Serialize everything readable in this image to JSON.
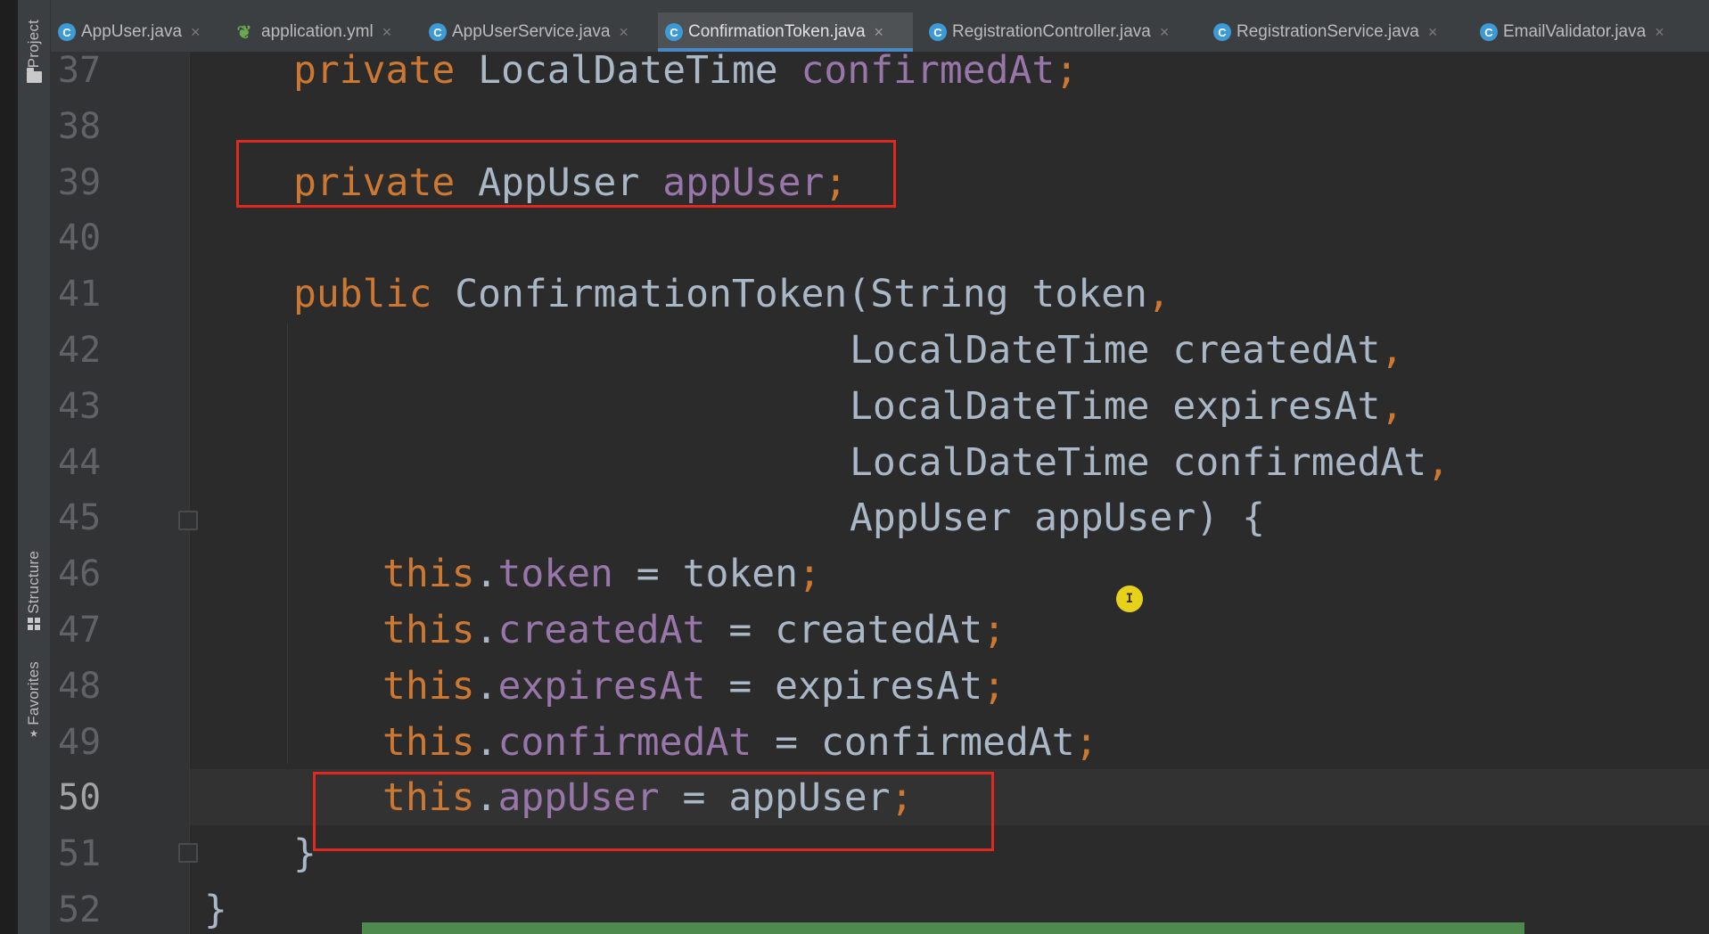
{
  "tabs": [
    {
      "label": "AppUser.java",
      "icon": "class-icon",
      "icon_letter": "C",
      "active": false,
      "closable": true
    },
    {
      "label": "application.yml",
      "icon": "spring-leaf-icon",
      "icon_letter": "",
      "active": false,
      "closable": true
    },
    {
      "label": "AppUserService.java",
      "icon": "class-icon",
      "icon_letter": "C",
      "active": false,
      "closable": true
    },
    {
      "label": "ConfirmationToken.java",
      "icon": "class-icon",
      "icon_letter": "C",
      "active": true,
      "closable": true
    },
    {
      "label": "RegistrationController.java",
      "icon": "class-icon",
      "icon_letter": "C",
      "active": false,
      "closable": true
    },
    {
      "label": "RegistrationService.java",
      "icon": "class-icon",
      "icon_letter": "C",
      "active": false,
      "closable": true
    },
    {
      "label": "EmailValidator.java",
      "icon": "class-icon",
      "icon_letter": "C",
      "active": false,
      "closable": true
    }
  ],
  "tool_stripe": {
    "project_label": "Project",
    "structure_label": "Structure",
    "favorites_label": "Favorites",
    "favorites_star": "★"
  },
  "editor": {
    "current_line": "50",
    "lines": [
      {
        "num": "37",
        "tokens": [
          {
            "t": "private ",
            "c": "kw"
          },
          {
            "t": "LocalDateTime ",
            "c": "pl"
          },
          {
            "t": "confirmedAt",
            "c": "fld"
          },
          {
            "t": ";",
            "c": "semi"
          }
        ]
      },
      {
        "num": "38",
        "tokens": []
      },
      {
        "num": "39",
        "tokens": [
          {
            "t": "private ",
            "c": "kw"
          },
          {
            "t": "AppUser ",
            "c": "pl"
          },
          {
            "t": "appUser",
            "c": "fld"
          },
          {
            "t": ";",
            "c": "semi"
          }
        ]
      },
      {
        "num": "40",
        "tokens": []
      },
      {
        "num": "41",
        "tokens": [
          {
            "t": "public ",
            "c": "kw"
          },
          {
            "t": "ConfirmationToken",
            "c": "ctor"
          },
          {
            "t": "(String token",
            "c": "pl"
          },
          {
            "t": ",",
            "c": "semi"
          }
        ]
      },
      {
        "num": "42",
        "tokens": [
          {
            "t": "LocalDateTime createdAt",
            "c": "pl"
          },
          {
            "t": ",",
            "c": "semi"
          }
        ]
      },
      {
        "num": "43",
        "tokens": [
          {
            "t": "LocalDateTime expiresAt",
            "c": "pl"
          },
          {
            "t": ",",
            "c": "semi"
          }
        ]
      },
      {
        "num": "44",
        "tokens": [
          {
            "t": "LocalDateTime confirmedAt",
            "c": "pl"
          },
          {
            "t": ",",
            "c": "semi"
          }
        ]
      },
      {
        "num": "45",
        "tokens": [
          {
            "t": "AppUser appUser) {",
            "c": "pl"
          }
        ]
      },
      {
        "num": "46",
        "tokens": [
          {
            "t": "this",
            "c": "kw"
          },
          {
            "t": ".",
            "c": "pl"
          },
          {
            "t": "token",
            "c": "fld"
          },
          {
            "t": " = token",
            "c": "pl"
          },
          {
            "t": ";",
            "c": "semi"
          }
        ]
      },
      {
        "num": "47",
        "tokens": [
          {
            "t": "this",
            "c": "kw"
          },
          {
            "t": ".",
            "c": "pl"
          },
          {
            "t": "createdAt",
            "c": "fld"
          },
          {
            "t": " = createdAt",
            "c": "pl"
          },
          {
            "t": ";",
            "c": "semi"
          }
        ]
      },
      {
        "num": "48",
        "tokens": [
          {
            "t": "this",
            "c": "kw"
          },
          {
            "t": ".",
            "c": "pl"
          },
          {
            "t": "expiresAt",
            "c": "fld"
          },
          {
            "t": " = expiresAt",
            "c": "pl"
          },
          {
            "t": ";",
            "c": "semi"
          }
        ]
      },
      {
        "num": "49",
        "tokens": [
          {
            "t": "this",
            "c": "kw"
          },
          {
            "t": ".",
            "c": "pl"
          },
          {
            "t": "confirmedAt",
            "c": "fld"
          },
          {
            "t": " = confirmedAt",
            "c": "pl"
          },
          {
            "t": ";",
            "c": "semi"
          }
        ]
      },
      {
        "num": "50",
        "tokens": [
          {
            "t": "this",
            "c": "kw"
          },
          {
            "t": ".",
            "c": "pl"
          },
          {
            "t": "appUser",
            "c": "fld"
          },
          {
            "t": " = appUser",
            "c": "pl"
          },
          {
            "t": ";",
            "c": "semi"
          }
        ]
      },
      {
        "num": "51",
        "tokens": [
          {
            "t": "}",
            "c": "pl"
          }
        ]
      },
      {
        "num": "52",
        "tokens": [
          {
            "t": "}",
            "c": "pl"
          }
        ]
      }
    ]
  },
  "colors": {
    "keyword": "#cc7832",
    "field": "#9876aa",
    "plain": "#a9b7c6",
    "highlight_box": "#e0281f",
    "active_tab_underline": "#4a88c7"
  },
  "cursor_icon": "text-cursor-icon"
}
